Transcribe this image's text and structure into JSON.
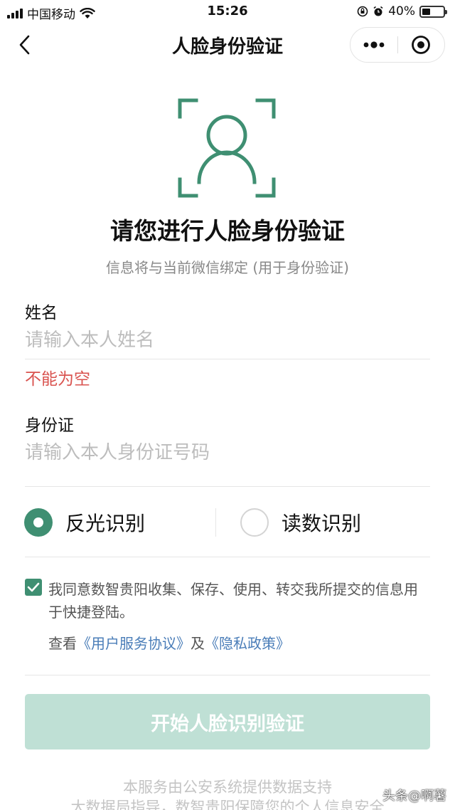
{
  "status_bar": {
    "carrier": "中国移动",
    "time": "15:26",
    "battery_percent": "40%",
    "battery_level": 0.4
  },
  "nav": {
    "title": "人脸身份验证"
  },
  "hero": {
    "title": "请您进行人脸身份验证",
    "subtitle": "信息将与当前微信绑定 (用于身份验证)"
  },
  "form": {
    "name_label": "姓名",
    "name_placeholder": "请输入本人姓名",
    "name_value": "",
    "name_error": "不能为空",
    "id_label": "身份证",
    "id_placeholder": "请输入本人身份证号码",
    "id_value": ""
  },
  "recognition": {
    "options": [
      {
        "label": "反光识别",
        "selected": true
      },
      {
        "label": "读数识别",
        "selected": false
      }
    ]
  },
  "agreement": {
    "checked": true,
    "text": "我同意数智贵阳收集、保存、使用、转交我所提交的信息用于快捷登陆。",
    "view_prefix": "查看",
    "user_agreement": "《用户服务协议》",
    "and_text": "及",
    "privacy_policy": "《隐私政策》"
  },
  "start_button": {
    "label": "开始人脸识别验证"
  },
  "footer": {
    "line1": "本服务由公安系统提供数据支持",
    "line2": "大数据局指导，数智贵阳保障您的个人信息安全"
  },
  "watermark": "头条@啊薯",
  "colors": {
    "accent": "#3f8f72",
    "button_disabled": "#bfe0d5",
    "error": "#d9534f",
    "link": "#4a7db8"
  }
}
